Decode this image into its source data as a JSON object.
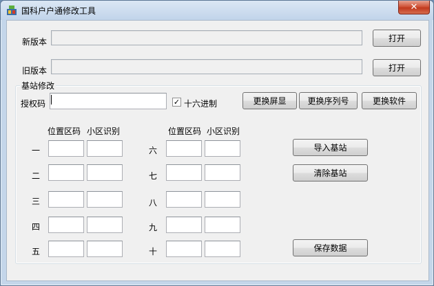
{
  "window": {
    "title": "国科户户通修改工具",
    "close_glyph": "✕"
  },
  "new_version": {
    "label": "新版本",
    "value": "",
    "open_button": "打开"
  },
  "old_version": {
    "label": "旧版本",
    "value": "",
    "open_button": "打开"
  },
  "station_group": {
    "title": "基站修改",
    "auth_label": "授权码",
    "auth_value": "",
    "hex_checkbox_label": "十六进制",
    "hex_checked": true,
    "check_glyph": "✓",
    "buttons": {
      "replace_screen": "更换屏显",
      "replace_serial": "更换序列号",
      "replace_software": "更换软件"
    },
    "left_headers": {
      "lac": "位置区码",
      "cell": "小区识别"
    },
    "right_headers": {
      "lac": "位置区码",
      "cell": "小区识别"
    },
    "rows_left": [
      "一",
      "二",
      "三",
      "四",
      "五"
    ],
    "rows_right": [
      "六",
      "七",
      "八",
      "九",
      "十"
    ],
    "actions": {
      "import": "导入基站",
      "clear": "清除基站",
      "save": "保存数据"
    }
  }
}
